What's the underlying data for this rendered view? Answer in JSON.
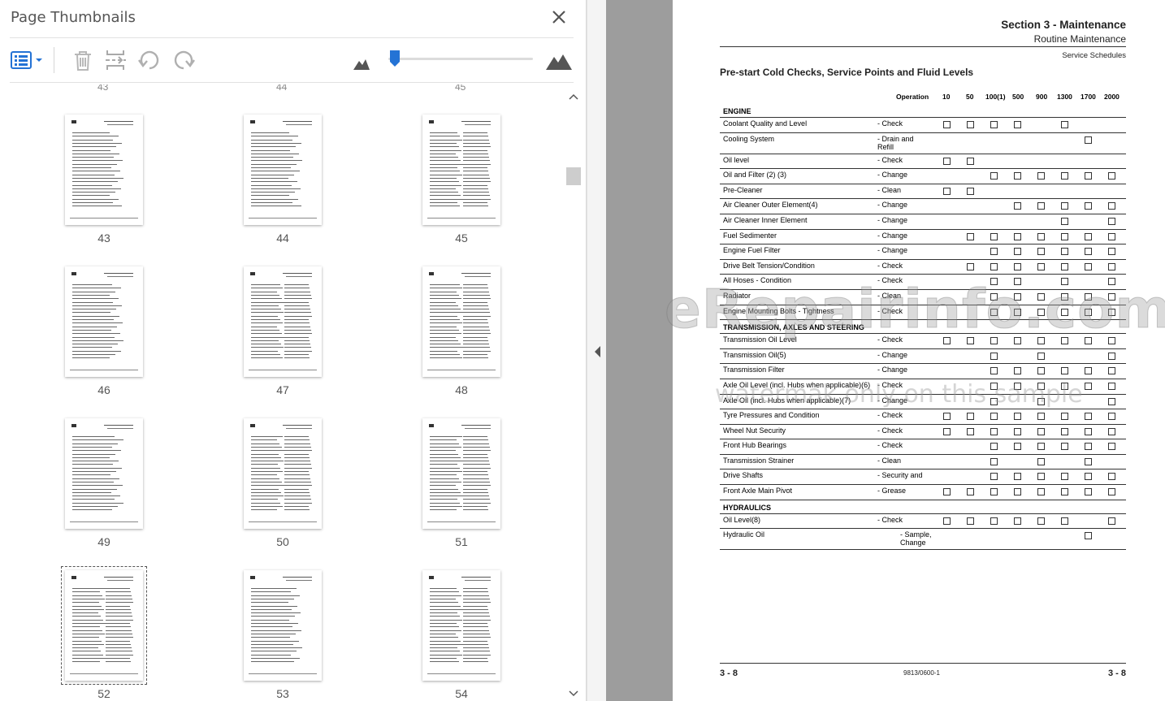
{
  "panel": {
    "title": "Page Thumbnails"
  },
  "thumbnails": {
    "prev_row_labels": [
      "43",
      "44",
      "45"
    ],
    "pages": [
      "43",
      "44",
      "45",
      "46",
      "47",
      "48",
      "49",
      "50",
      "51",
      "52",
      "53",
      "54"
    ],
    "selected": "52"
  },
  "icons": {
    "close": "close-icon",
    "options": "thumbnail-options-icon",
    "delete": "trash-icon",
    "insert": "insert-pages-icon",
    "rotate_ccw": "rotate-counterclockwise-icon",
    "rotate_cw": "rotate-clockwise-icon",
    "zoom_out": "mountain-small-icon",
    "zoom_in": "mountain-large-icon"
  },
  "colors": {
    "accent": "#2473d5",
    "gutter": "#9d9d9d"
  },
  "document": {
    "section_title": "Section 3 - Maintenance",
    "section_subtitle": "Routine Maintenance",
    "section_schedule": "Service Schedules",
    "table_heading": "Pre-start Cold Checks, Service Points and Fluid Levels",
    "columns": {
      "operation": "Operation",
      "intervals": [
        "10",
        "50",
        "100(1)",
        "500",
        "900",
        "1300",
        "1700",
        "2000"
      ]
    },
    "groups": [
      {
        "name": "ENGINE",
        "rows": [
          {
            "item": "Coolant Quality and Level",
            "op": "- Check",
            "checks": [
              1,
              1,
              1,
              1,
              0,
              1,
              0,
              0
            ]
          },
          {
            "item": "Cooling System",
            "op": "- Drain and Refill",
            "checks": [
              0,
              0,
              0,
              0,
              0,
              0,
              1,
              0
            ]
          },
          {
            "item": "Oil level",
            "op": "- Check",
            "checks": [
              1,
              1,
              0,
              0,
              0,
              0,
              0,
              0
            ]
          },
          {
            "item": "Oil and Filter (2) (3)",
            "op": "- Change",
            "checks": [
              0,
              0,
              1,
              1,
              1,
              1,
              1,
              1
            ]
          },
          {
            "item": "Pre-Cleaner",
            "op": "- Clean",
            "checks": [
              1,
              1,
              0,
              0,
              0,
              0,
              0,
              0
            ]
          },
          {
            "item": "Air Cleaner Outer Element(4)",
            "op": "- Change",
            "checks": [
              0,
              0,
              0,
              1,
              1,
              1,
              1,
              1
            ]
          },
          {
            "item": "Air Cleaner Inner Element",
            "op": "- Change",
            "checks": [
              0,
              0,
              0,
              0,
              0,
              1,
              0,
              1
            ]
          },
          {
            "item": "Fuel Sedimenter",
            "op": "- Change",
            "checks": [
              0,
              1,
              1,
              1,
              1,
              1,
              1,
              1
            ]
          },
          {
            "item": "Engine Fuel Filter",
            "op": "- Change",
            "checks": [
              0,
              0,
              1,
              1,
              1,
              1,
              1,
              1
            ]
          },
          {
            "item": "Drive Belt Tension/Condition",
            "op": "- Check",
            "checks": [
              0,
              1,
              1,
              1,
              1,
              1,
              1,
              1
            ]
          },
          {
            "item": "All Hoses - Condition",
            "op": "- Check",
            "checks": [
              0,
              0,
              1,
              1,
              0,
              1,
              0,
              1
            ]
          },
          {
            "item": "Radiator",
            "op": "- Clean",
            "checks": [
              0,
              0,
              1,
              1,
              1,
              1,
              1,
              1
            ]
          },
          {
            "item": "Engine Mounting Bolts - Tightness",
            "op": "- Check",
            "checks": [
              0,
              0,
              1,
              1,
              1,
              1,
              1,
              1
            ]
          }
        ]
      },
      {
        "name": "TRANSMISSION, AXLES AND STEERING",
        "rows": [
          {
            "item": "Transmission Oil Level",
            "op": "- Check",
            "checks": [
              1,
              1,
              1,
              1,
              1,
              1,
              1,
              1
            ]
          },
          {
            "item": "Transmission Oil(5)",
            "op": "- Change",
            "checks": [
              0,
              0,
              1,
              0,
              1,
              0,
              0,
              1
            ]
          },
          {
            "item": "Transmission Filter",
            "op": "- Change",
            "checks": [
              0,
              0,
              1,
              1,
              1,
              1,
              1,
              1
            ]
          },
          {
            "item": "Axle Oil Level (incl. Hubs when applicable)(6)",
            "op": "- Check",
            "checks": [
              0,
              0,
              1,
              1,
              1,
              1,
              1,
              1
            ]
          },
          {
            "item": "Axle Oil (incl. Hubs when applicable)(7)",
            "op": "- Change",
            "checks": [
              0,
              0,
              1,
              0,
              1,
              0,
              0,
              1
            ]
          },
          {
            "item": "Tyre Pressures and Condition",
            "op": "- Check",
            "checks": [
              1,
              1,
              1,
              1,
              1,
              1,
              1,
              1
            ]
          },
          {
            "item": "Wheel Nut Security",
            "op": "- Check",
            "checks": [
              1,
              1,
              1,
              1,
              1,
              1,
              1,
              1
            ]
          },
          {
            "item": "Front Hub Bearings",
            "op": "- Check",
            "checks": [
              0,
              0,
              1,
              1,
              1,
              1,
              1,
              1
            ]
          },
          {
            "item": "Transmission Strainer",
            "op": "- Clean",
            "checks": [
              0,
              0,
              1,
              0,
              1,
              0,
              1,
              0
            ]
          },
          {
            "item": "Drive Shafts",
            "op": "- Security and",
            "checks": [
              0,
              0,
              1,
              1,
              1,
              1,
              1,
              1
            ]
          },
          {
            "item": "Front Axle Main Pivot",
            "op": "- Grease",
            "checks": [
              1,
              1,
              1,
              1,
              1,
              1,
              1,
              1
            ]
          }
        ]
      },
      {
        "name": "HYDRAULICS",
        "rows": [
          {
            "item": "Oil Level(8)",
            "op": "- Check",
            "checks": [
              1,
              1,
              1,
              1,
              1,
              1,
              0,
              1
            ]
          },
          {
            "item": "Hydraulic Oil",
            "op": "- Sample, Change",
            "checks": [
              0,
              0,
              0,
              0,
              0,
              0,
              1,
              0
            ]
          }
        ]
      }
    ],
    "footer": {
      "left": "3 - 8",
      "mid": "9813/0600-1",
      "right": "3 - 8"
    }
  },
  "watermark": {
    "line1": "eRepairinfo.com",
    "line2": "watermak only on this sample"
  }
}
